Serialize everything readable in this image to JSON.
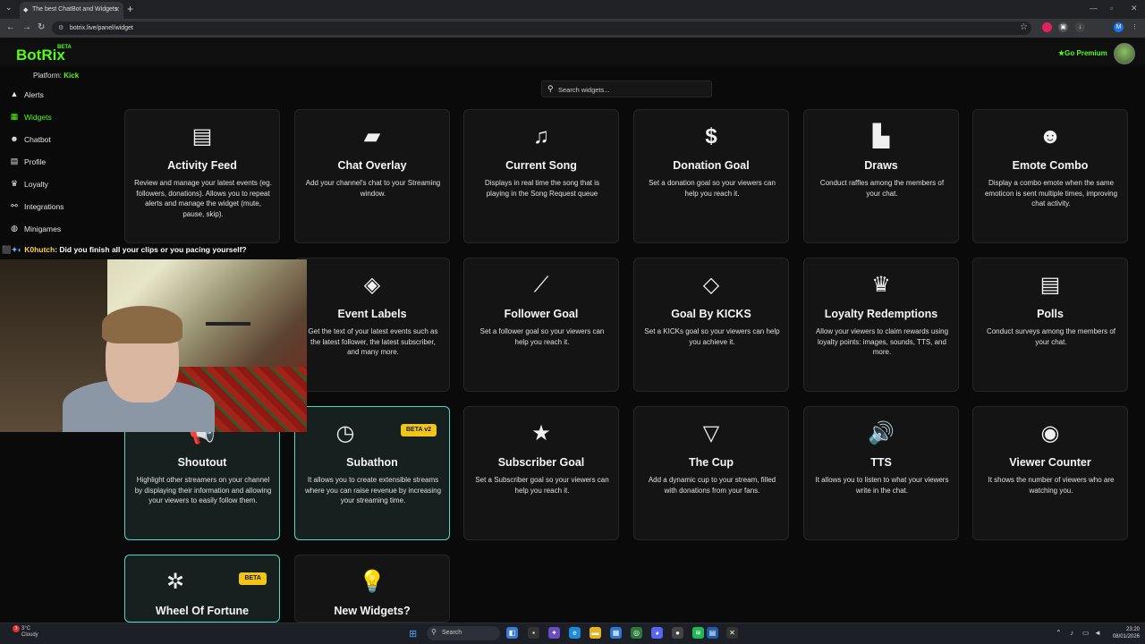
{
  "browser": {
    "tab_title": "The best ChatBot and Widgets",
    "url": "botrix.live/panel/widget",
    "profile_initial": "M"
  },
  "header": {
    "logo": "BotRix",
    "beta": "BETA",
    "platform_label": "Platform:",
    "platform_value": "Kick",
    "premium": "Go Premium"
  },
  "sidebar": {
    "items": [
      {
        "label": "Alerts",
        "icon": "warning-icon"
      },
      {
        "label": "Widgets",
        "icon": "grid-icon",
        "active": true
      },
      {
        "label": "Chatbot",
        "icon": "robot-icon"
      },
      {
        "label": "Profile",
        "icon": "id-card-icon"
      },
      {
        "label": "Loyalty",
        "icon": "trophy-icon"
      },
      {
        "label": "Integrations",
        "icon": "link-icon"
      },
      {
        "label": "Minigames",
        "icon": "gamepad-icon"
      }
    ]
  },
  "search": {
    "placeholder": "Search widgets..."
  },
  "widgets": [
    {
      "title": "Activity Feed",
      "desc": "Review and manage your latest events (eg. followers, donations). Allows you to repeat alerts and manage the widget (mute, pause, skip).",
      "icon": "list-icon"
    },
    {
      "title": "Chat Overlay",
      "desc": "Add your channel's chat to your Streaming window.",
      "icon": "chat-bubble-icon"
    },
    {
      "title": "Current Song",
      "desc": "Displays in real time the song that is playing in the Song Request queue",
      "icon": "music-note-icon"
    },
    {
      "title": "Donation Goal",
      "desc": "Set a donation goal so your viewers can help you reach it.",
      "icon": "dollar-icon"
    },
    {
      "title": "Draws",
      "desc": "Conduct raffles among the members of your chat.",
      "icon": "gifts-icon"
    },
    {
      "title": "Emote Combo",
      "desc": "Display a combo emote when the same emoticon is sent multiple times, improving chat activity.",
      "icon": "face-icon"
    },
    {
      "title": "Event Labels",
      "desc": "Get the text of your latest events such as the latest follower, the latest subscriber, and many more.",
      "icon": "tags-icon"
    },
    {
      "title": "Follower Goal",
      "desc": "Set a follower goal so your viewers can help you reach it.",
      "icon": "chart-line-icon"
    },
    {
      "title": "Goal By KICKS",
      "desc": "Set a KICKs goal so your viewers can help you achieve it.",
      "icon": "gem-icon"
    },
    {
      "title": "Loyalty Redemptions",
      "desc": "Allow your viewers to claim rewards using loyalty points: images, sounds, TTS, and more.",
      "icon": "trophy-icon"
    },
    {
      "title": "Polls",
      "desc": "Conduct surveys among the members of your chat.",
      "icon": "poll-icon"
    },
    {
      "title": "Shoutout",
      "desc": "Highlight other streamers on your channel by displaying their information and allowing your viewers to easily follow them.",
      "icon": "megaphone-icon",
      "featured": true
    },
    {
      "title": "Subathon",
      "desc": "It allows you to create extensible streams where you can raise revenue by increasing your streaming time.",
      "icon": "clock-icon",
      "featured": true,
      "badge": "BETA v2"
    },
    {
      "title": "Subscriber Goal",
      "desc": "Set a Subscriber goal so your viewers can help you reach it.",
      "icon": "star-icon"
    },
    {
      "title": "The Cup",
      "desc": "Add a dynamic cup to your stream, filled with donations from your fans.",
      "icon": "cocktail-icon"
    },
    {
      "title": "TTS",
      "desc": "It allows you to listen to what your viewers write in the chat.",
      "icon": "speaker-icon"
    },
    {
      "title": "Viewer Counter",
      "desc": "It shows the number of viewers who are watching you.",
      "icon": "eye-icon"
    },
    {
      "title": "Wheel Of Fortune",
      "desc": "",
      "icon": "wheel-icon",
      "featured": true,
      "badge": "BETA"
    },
    {
      "title": "New Widgets?",
      "desc": "",
      "icon": "lightbulb-icon"
    }
  ],
  "chat_overlay": {
    "user": "K0hutch",
    "message": ": Did you finish all your clips or you pacing yourself?"
  },
  "taskbar": {
    "weather_temp": "3°C",
    "weather_desc": "Cloudy",
    "search": "Search",
    "time": "23:20",
    "date": "08/01/2026"
  }
}
